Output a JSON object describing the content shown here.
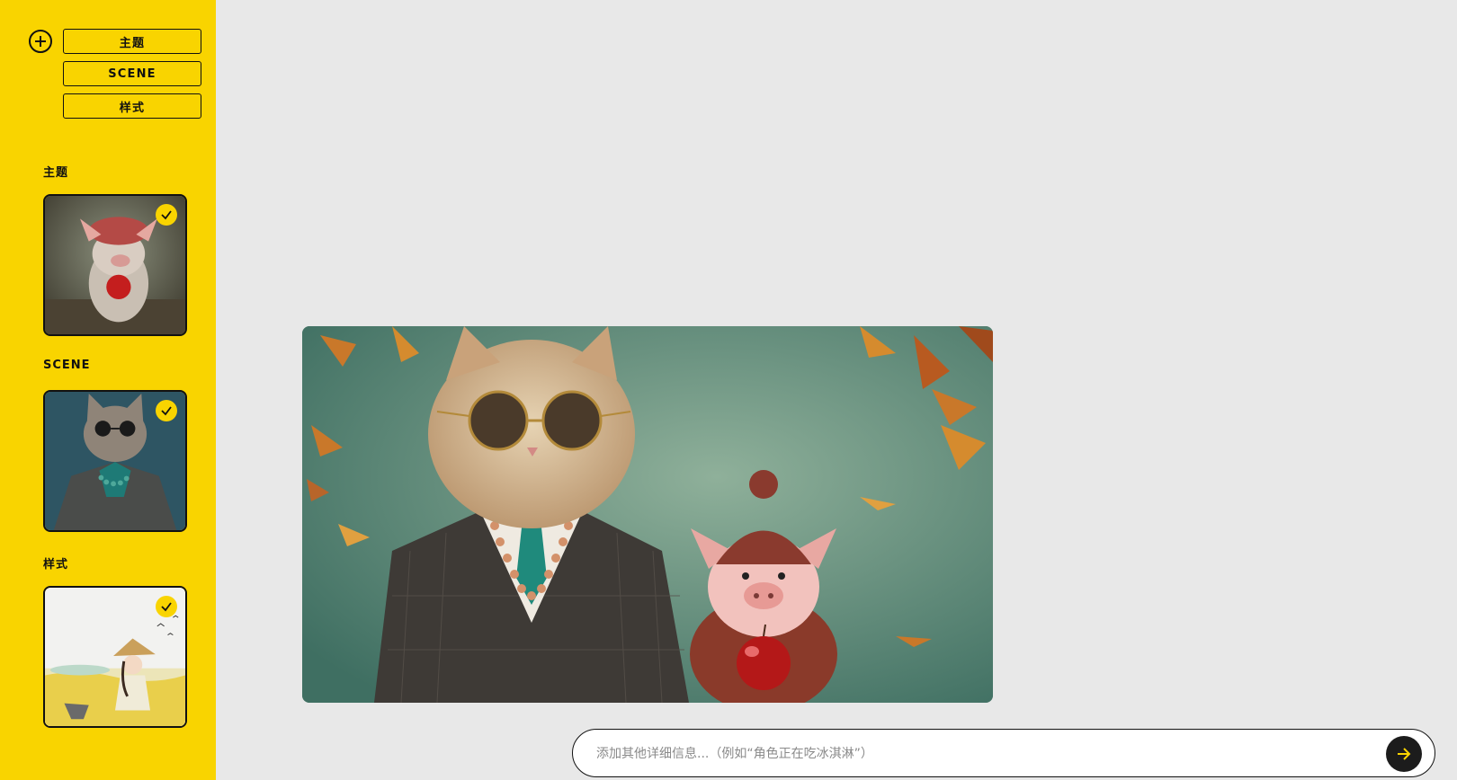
{
  "sidebar": {
    "add_icon": "plus-circle-icon",
    "tabs": [
      {
        "label": "主题"
      },
      {
        "label": "SCENE"
      },
      {
        "label": "样式"
      }
    ],
    "sections": [
      {
        "label": "主题",
        "thumb": "pig-in-knit-hat-with-apple",
        "selected": true
      },
      {
        "label": "SCENE",
        "thumb": "cat-in-suit-with-sunglasses",
        "selected": true
      },
      {
        "label": "样式",
        "thumb": "girl-with-straw-hat-illustration",
        "selected": true
      }
    ],
    "check_icon": "checkmark-icon"
  },
  "main": {
    "preview_image": "cat-in-suit-and-pig-with-apple-autumn-leaves"
  },
  "prompt": {
    "placeholder": "添加其他详细信息...（例如“角色正在吃冰淇淋”）",
    "value": "",
    "send_icon": "arrow-right-icon"
  },
  "colors": {
    "accent": "#f9d400",
    "background": "#e8e8e8",
    "dark": "#1c1c1c"
  }
}
